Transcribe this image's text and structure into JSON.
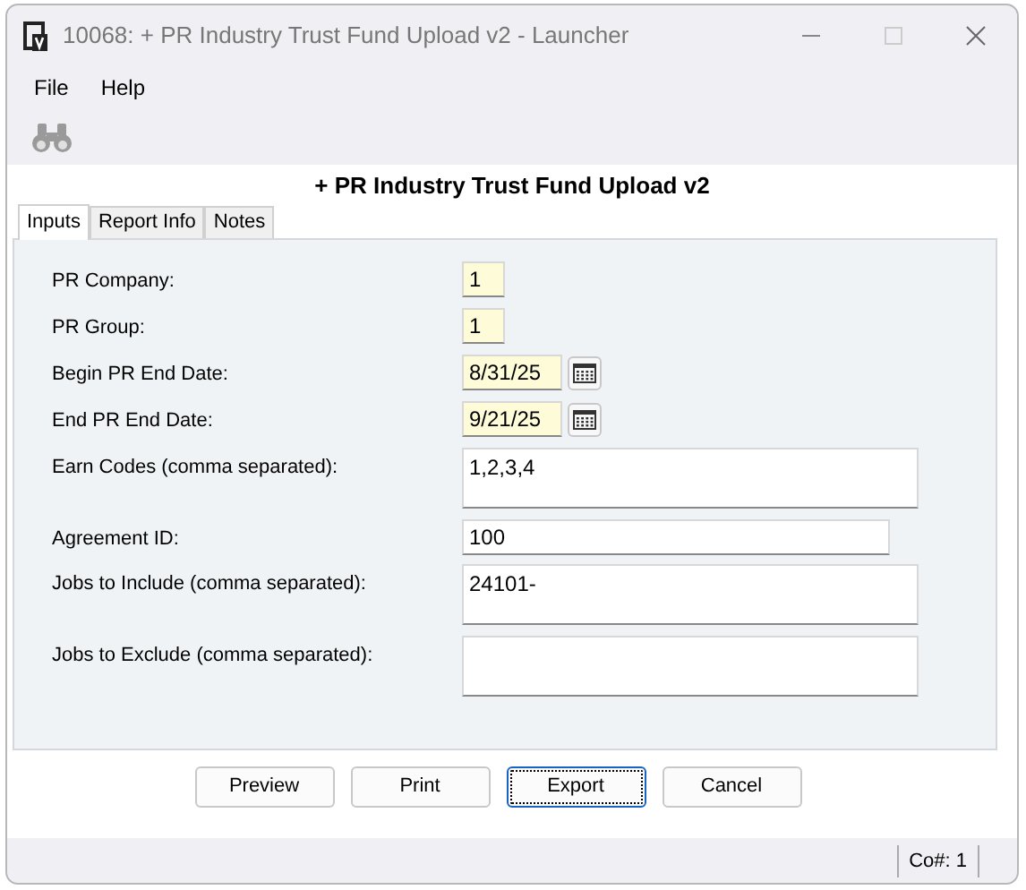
{
  "window": {
    "title": "10068: + PR Industry Trust Fund Upload v2 - Launcher"
  },
  "menu": [
    "File",
    "Help"
  ],
  "report_title": "+ PR Industry Trust Fund Upload v2",
  "tabs": [
    {
      "label": "Inputs",
      "selected": true
    },
    {
      "label": "Report Info",
      "selected": false
    },
    {
      "label": "Notes",
      "selected": false
    }
  ],
  "fields": [
    {
      "label": "PR Company:",
      "value": "1",
      "kind": "short"
    },
    {
      "label": "PR Group:",
      "value": "1",
      "kind": "short"
    },
    {
      "label": "Begin PR End Date:",
      "value": "8/31/25",
      "kind": "date"
    },
    {
      "label": "End PR End Date:",
      "value": "9/21/25",
      "kind": "date"
    },
    {
      "label": "Earn Codes (comma separated):",
      "value": "1,2,3,4",
      "kind": "multiline"
    },
    {
      "label": "Agreement ID:",
      "value": "100",
      "kind": "line"
    },
    {
      "label": "Jobs to Include (comma separated):",
      "value": "24101-",
      "kind": "multiline"
    },
    {
      "label": "Jobs to Exclude (comma separated):",
      "kind": "multiline"
    }
  ],
  "buttons": [
    {
      "label": "Preview",
      "focused": false
    },
    {
      "label": "Print",
      "focused": false
    },
    {
      "label": "Export",
      "focused": true
    },
    {
      "label": "Cancel",
      "focused": false
    }
  ],
  "status_bar": {
    "company": "Co#: 1"
  }
}
